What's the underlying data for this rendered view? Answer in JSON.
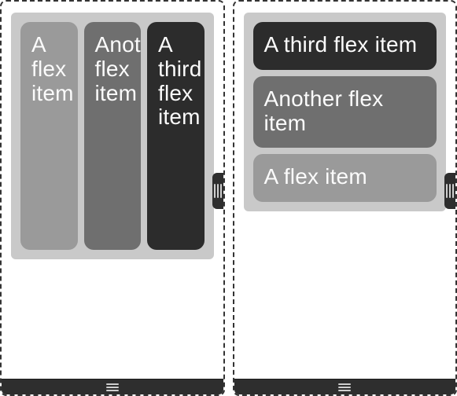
{
  "left": {
    "items": [
      {
        "label": "A flex item"
      },
      {
        "label": "Another flex item"
      },
      {
        "label": "A third flex item"
      }
    ]
  },
  "right": {
    "items": [
      {
        "label": "A third flex item"
      },
      {
        "label": "Another flex item"
      },
      {
        "label": "A flex item"
      }
    ]
  }
}
